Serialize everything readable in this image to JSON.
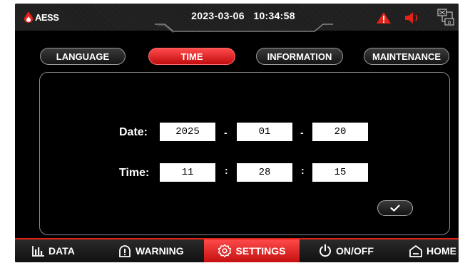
{
  "header": {
    "brand": "AESS",
    "date": "2023-03-06",
    "time": "10:34:58",
    "icons": [
      "alarm-triangle-icon",
      "speaker-icon",
      "communication-icon"
    ],
    "colors": {
      "accent": "#e2231a",
      "background": "#000000"
    }
  },
  "tabs": [
    {
      "label": "LANGUAGE",
      "active": false
    },
    {
      "label": "TIME",
      "active": true
    },
    {
      "label": "INFORMATION",
      "active": false
    },
    {
      "label": "MAINTENANCE",
      "active": false
    }
  ],
  "form": {
    "date_label": "Date:",
    "time_label": "Time:",
    "year": "2025",
    "month": "01",
    "day": "20",
    "hour": "11",
    "minute": "28",
    "second": "15",
    "date_separator": "-",
    "time_separator": ":"
  },
  "nav": [
    {
      "label": "DATA",
      "icon": "bar-chart-icon",
      "active": false
    },
    {
      "label": "WARNING",
      "icon": "warning-icon",
      "active": false
    },
    {
      "label": "SETTINGS",
      "icon": "gear-icon",
      "active": true
    },
    {
      "label": "ON/OFF",
      "icon": "power-icon",
      "active": false
    },
    {
      "label": "HOME",
      "icon": "home-icon",
      "active": false
    }
  ]
}
